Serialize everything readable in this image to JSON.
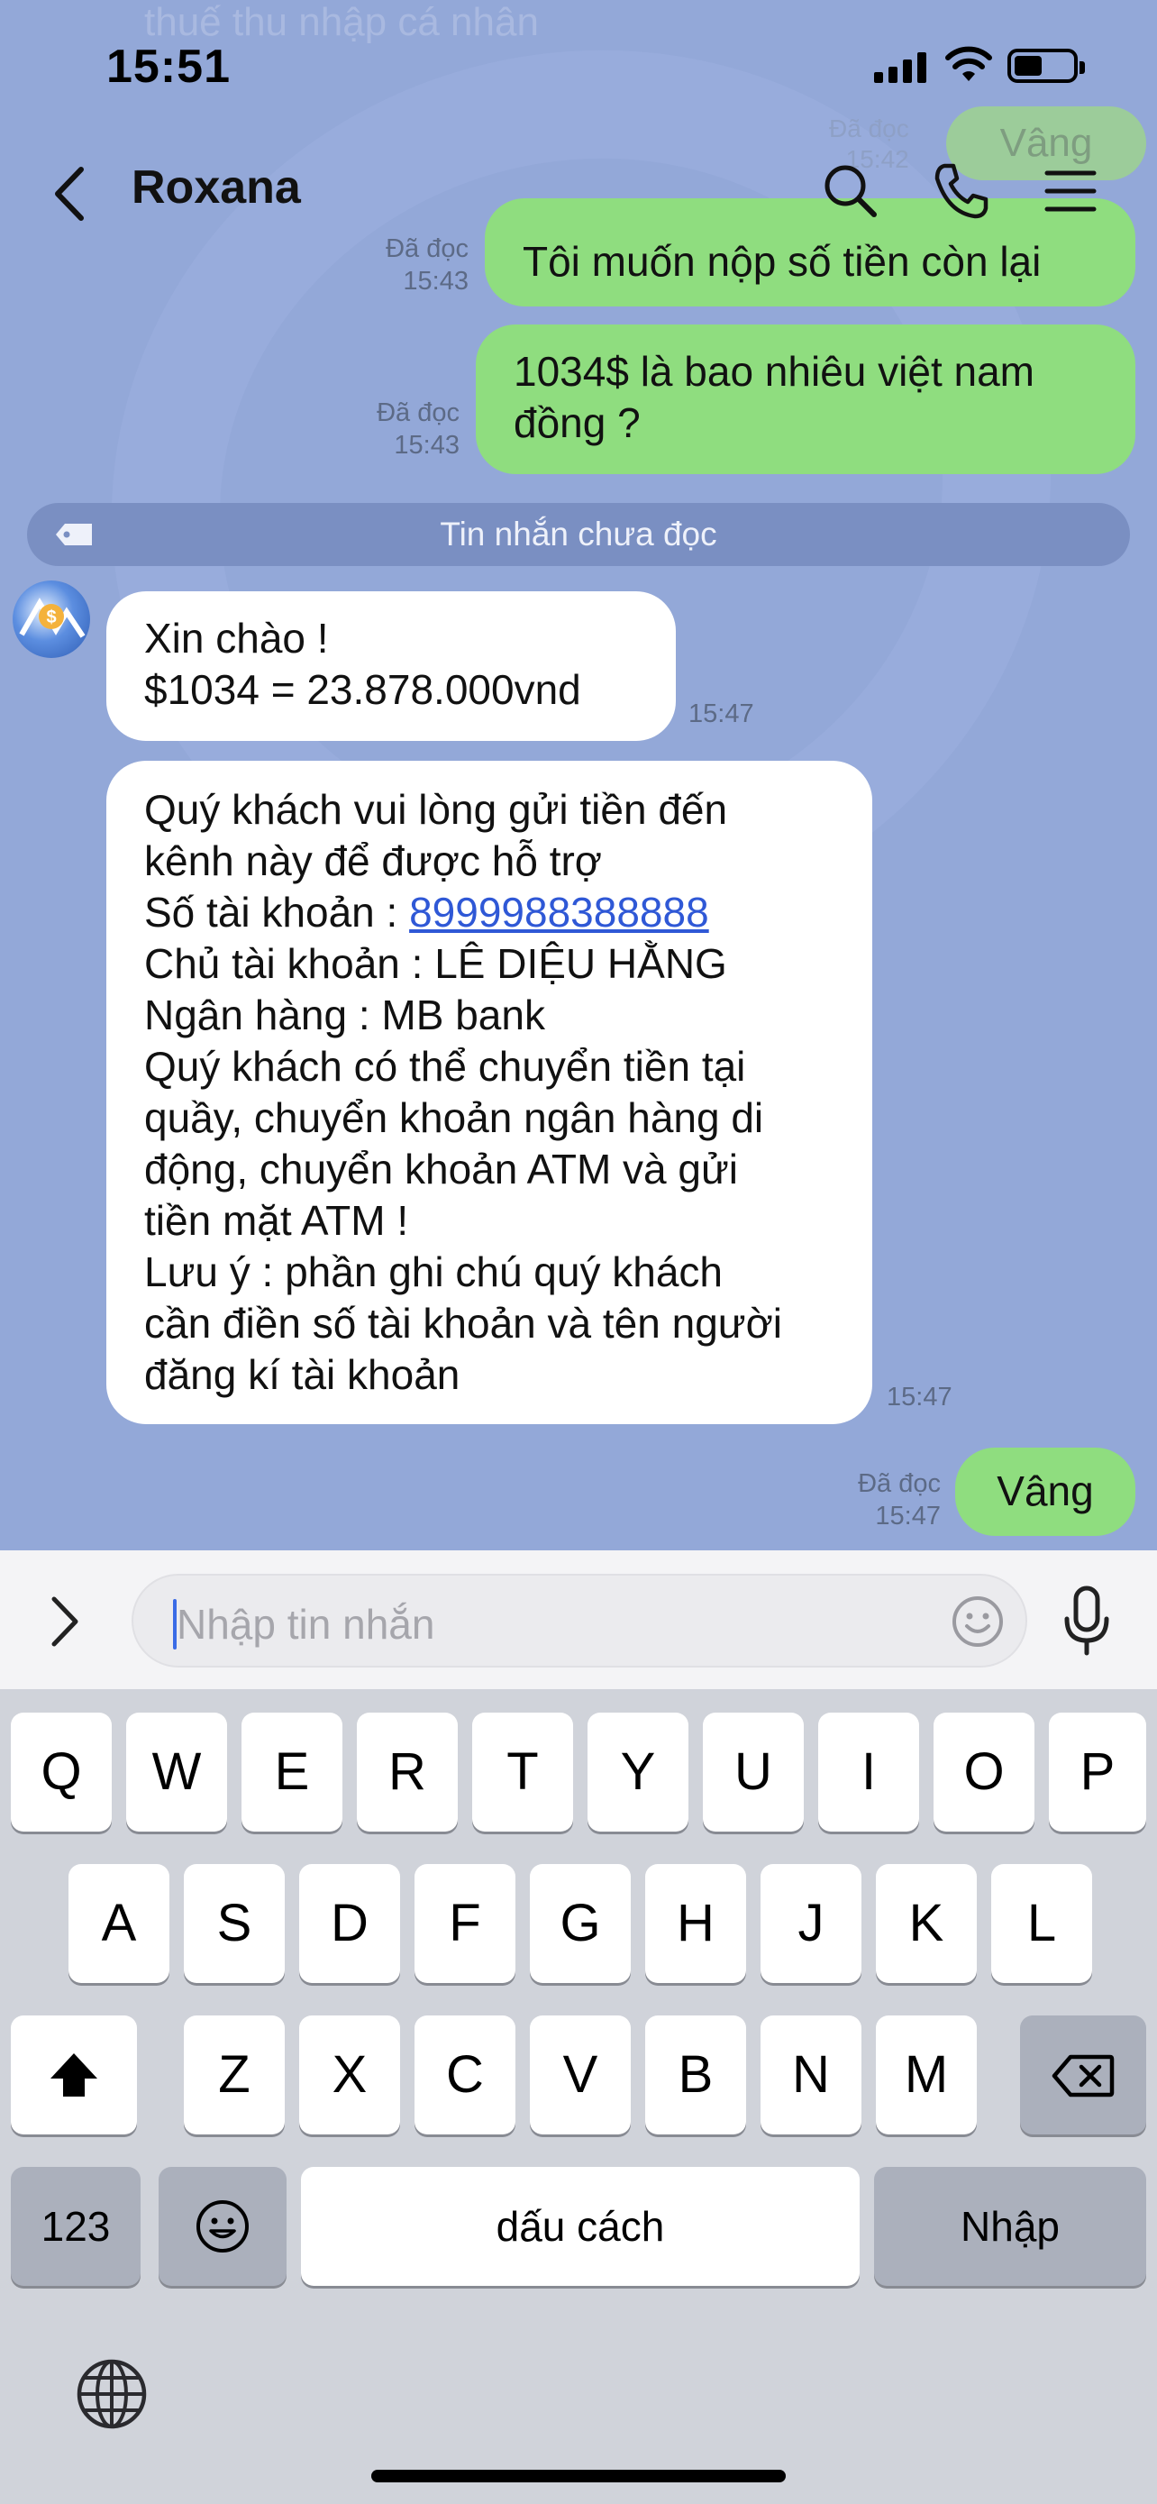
{
  "status_bar": {
    "time": "15:51"
  },
  "background_ghost": {
    "text": "thuế thu nhập cá nhân",
    "read": "Đã đọc",
    "read_time": "15:42",
    "bubble": "Vâng"
  },
  "header": {
    "contact_name": "Roxana"
  },
  "messages": {
    "m1": {
      "text": "Tôi muốn nộp số tiền còn lại",
      "read": "Đã đọc",
      "time": "15:43"
    },
    "m2": {
      "lines": [
        "1034$ là bao nhiêu việt nam",
        "đồng ?"
      ],
      "read": "Đã đọc",
      "time": "15:43"
    },
    "unread_divider": "Tin nhắn chưa đọc",
    "m3": {
      "lines": [
        "Xin chào !",
        "$1034 = 23.878.000vnd"
      ],
      "time": "15:47"
    },
    "m4": {
      "lines": [
        "Quý khách vui lòng gửi tiền đến",
        "kênh này để được hỗ trợ",
        "Số tài khoản : ",
        "Chủ tài khoản : LÊ DIỆU HẰNG",
        "Ngân hàng : MB bank",
        "Quý khách có thể chuyển tiền tại",
        "quầy, chuyển khoản ngân hàng di",
        "động, chuyển khoản ATM và gửi",
        "tiền mặt ATM !",
        "Lưu ý : phần ghi chú quý khách",
        "cần điền số tài khoản và tên người",
        "đăng kí tài khoản"
      ],
      "account_number": "8999988388888",
      "time": "15:47"
    },
    "m5": {
      "text": "Vâng",
      "read": "Đã đọc",
      "time": "15:47"
    }
  },
  "input": {
    "placeholder": "Nhập tin nhắn"
  },
  "keyboard": {
    "row1": [
      "Q",
      "W",
      "E",
      "R",
      "T",
      "Y",
      "U",
      "I",
      "O",
      "P"
    ],
    "row2": [
      "A",
      "S",
      "D",
      "F",
      "G",
      "H",
      "J",
      "K",
      "L"
    ],
    "row3": [
      "Z",
      "X",
      "C",
      "V",
      "B",
      "N",
      "M"
    ],
    "numbers_key": "123",
    "space_key": "dấu cách",
    "return_key": "Nhập"
  },
  "icons": [
    "back-icon",
    "search-icon",
    "phone-icon",
    "menu-icon",
    "tag-icon",
    "chevron-right-icon",
    "emoji-icon",
    "microphone-icon",
    "shift-icon",
    "backspace-icon",
    "emoji-keyboard-icon",
    "globe-icon"
  ]
}
